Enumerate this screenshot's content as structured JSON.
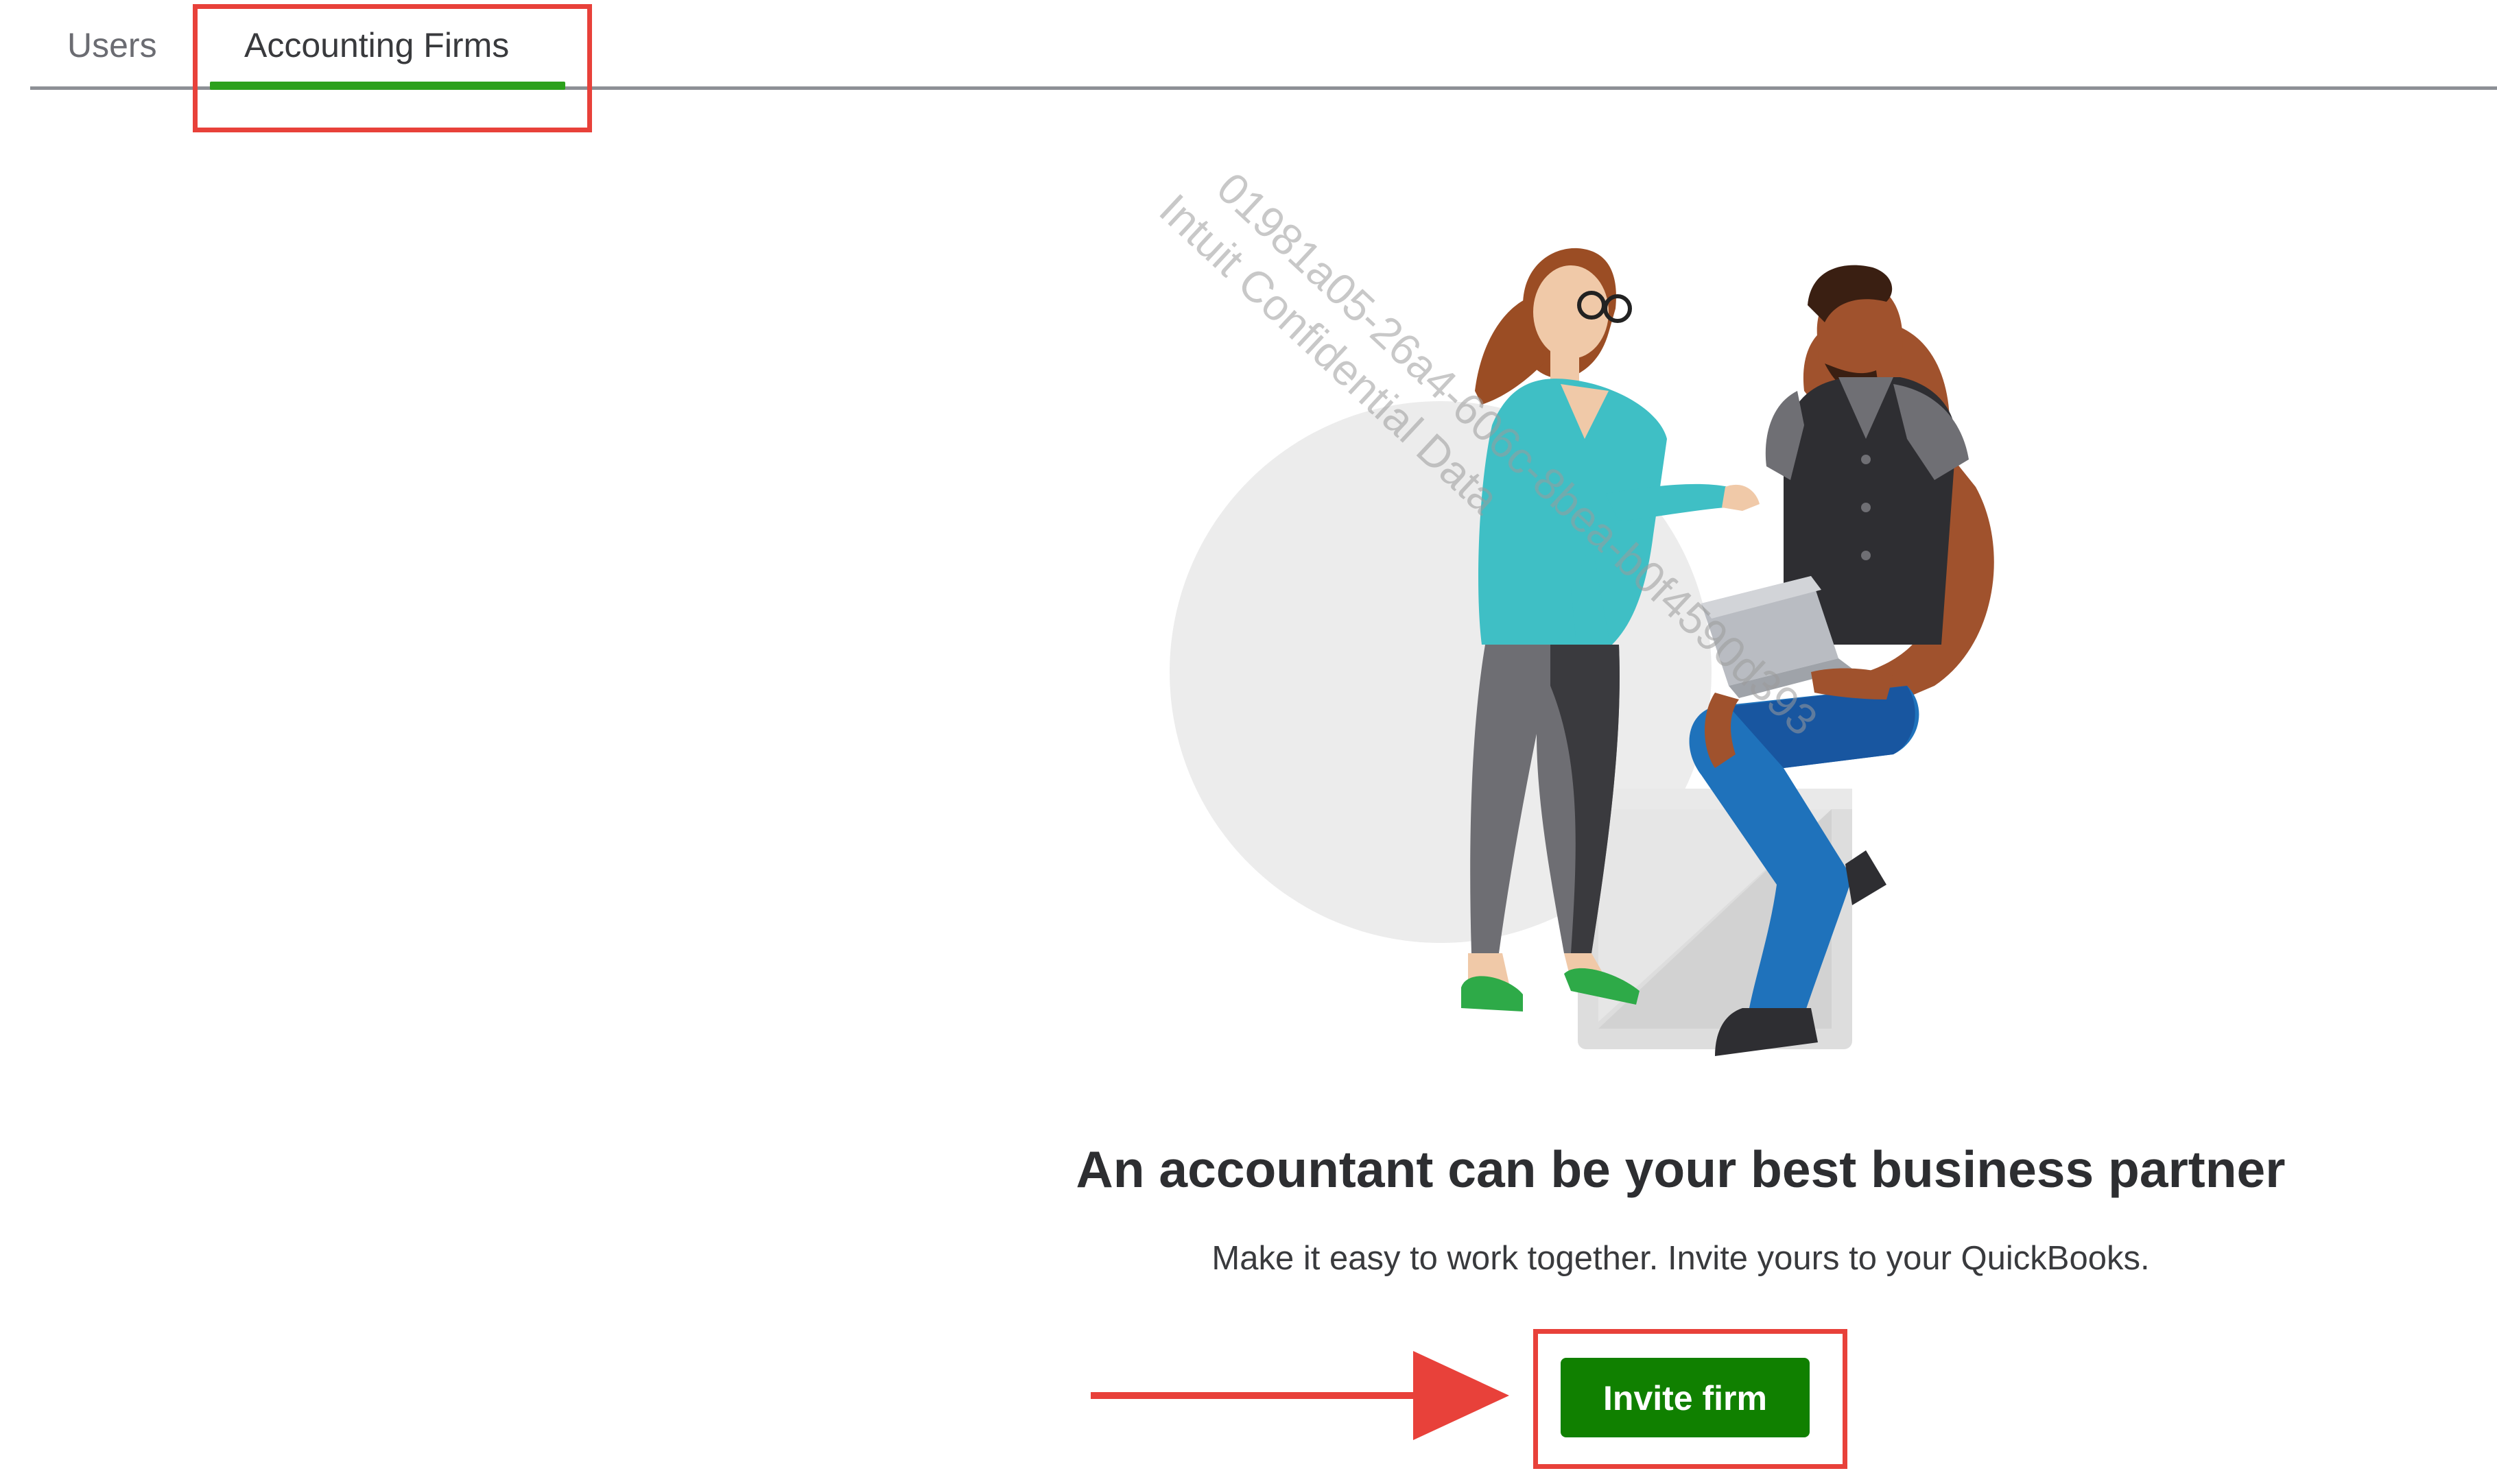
{
  "tabs": [
    {
      "label": "Users",
      "active": false
    },
    {
      "label": "Accounting Firms",
      "active": true
    }
  ],
  "watermark": {
    "line1": "01981a05-26a4-606c-8bea-b0f4590d393",
    "line2": "Intuit Confidential Data"
  },
  "empty_state": {
    "headline": "An accountant can be your best business partner",
    "subtext": "Make it easy to work together. Invite yours to your QuickBooks.",
    "invite_button_label": "Invite firm"
  },
  "colors": {
    "accent_green": "#2ca01c",
    "button_green": "#108000",
    "annotation_red": "#e8413a"
  },
  "icons": [
    "woman-figure-illustration",
    "man-with-laptop-illustration",
    "red-arrow-annotation"
  ]
}
